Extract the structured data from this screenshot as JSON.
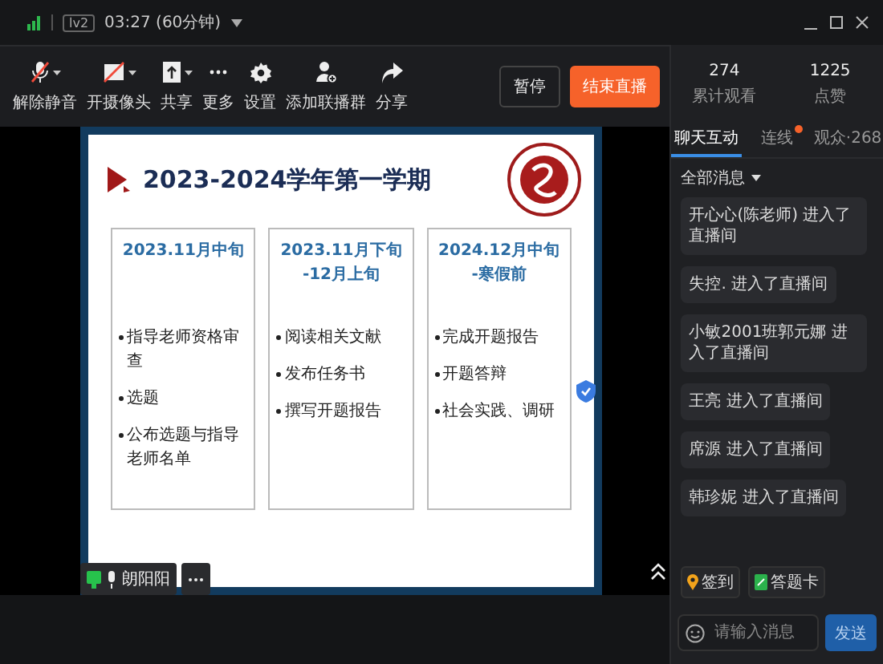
{
  "title_bar": {
    "level_badge": "lv2",
    "duration": "03:27 (60分钟)"
  },
  "toolbar": [
    {
      "kind": "mic",
      "label": "解除静音",
      "has_menu": true
    },
    {
      "kind": "camera",
      "label": "开摄像头",
      "has_menu": true
    },
    {
      "kind": "share-screen",
      "label": "共享",
      "has_menu": true
    },
    {
      "kind": "more",
      "label": "更多",
      "has_menu": false
    },
    {
      "kind": "settings",
      "label": "设置",
      "has_menu": false
    },
    {
      "kind": "group",
      "label": "添加联播群",
      "has_menu": false
    },
    {
      "kind": "share",
      "label": "分享",
      "has_menu": false
    }
  ],
  "actions": {
    "pause": "暂停",
    "end": "结束直播"
  },
  "slide": {
    "title": "2023-2024学年第一学期",
    "cards": [
      {
        "heading": [
          "2023.11月中旬"
        ],
        "items": [
          "指导老师资格审查",
          "选题",
          "公布选题与指导老师名单"
        ]
      },
      {
        "heading": [
          "2023.11月下旬",
          "-12月上旬"
        ],
        "items": [
          "阅读相关文献",
          "发布任务书",
          "撰写开题报告"
        ]
      },
      {
        "heading": [
          "2024.12月中旬",
          "-寒假前"
        ],
        "items": [
          "完成开题报告",
          "开题答辩",
          "社会实践、调研"
        ]
      }
    ]
  },
  "presenter": {
    "name": "朗阳阳"
  },
  "stats": [
    {
      "value": "274",
      "label": "累计观看"
    },
    {
      "value": "1225",
      "label": "点赞"
    }
  ],
  "tabs": [
    {
      "label": "聊天互动",
      "selected": true,
      "badge": false
    },
    {
      "label": "连线",
      "selected": false,
      "badge": true
    },
    {
      "label": "观众·268",
      "selected": false,
      "badge": false
    }
  ],
  "filter": "全部消息",
  "messages": [
    "开心心(陈老师) 进入了直播间",
    "失控. 进入了直播间",
    "小敏2001班郭元娜 进入了直播间",
    "王亮 进入了直播间",
    "席源 进入了直播间",
    "韩珍妮 进入了直播间"
  ],
  "quick_buttons": [
    {
      "kind": "checkin",
      "label": "签到"
    },
    {
      "kind": "answer-card",
      "label": "答题卡"
    }
  ],
  "composer": {
    "placeholder": "请输入消息",
    "send": "发送"
  }
}
